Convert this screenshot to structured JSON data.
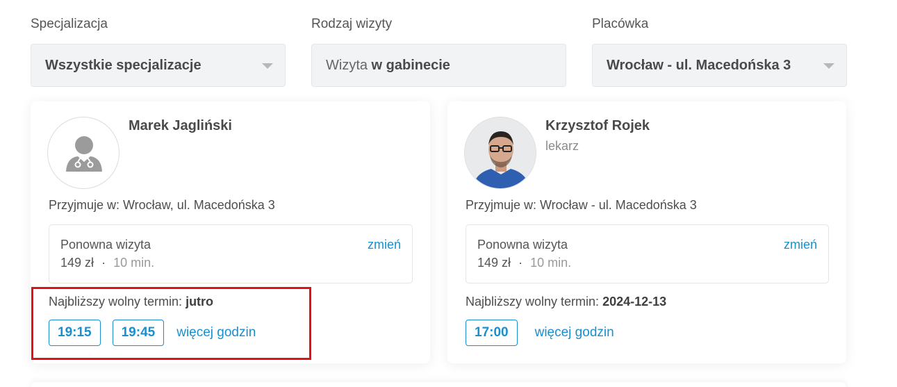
{
  "filters": {
    "specialization": {
      "label": "Specjalizacja",
      "value": "Wszystkie specjalizacje"
    },
    "visit_type": {
      "label": "Rodzaj wizyty",
      "value_prefix": "Wizyta",
      "value_bold": " w gabinecie"
    },
    "facility": {
      "label": "Placówka",
      "value": "Wrocław - ul. Macedońska 3"
    }
  },
  "doctors": [
    {
      "name": "Marek Jagliński",
      "role": "",
      "avatar": "doctor-placeholder-icon",
      "location": "Przyjmuje w: Wrocław, ul. Macedońska 3",
      "visit": {
        "name": "Ponowna wizyta",
        "price": "149 zł",
        "separator": "·",
        "duration": "10 min.",
        "change": "zmień"
      },
      "nearest_label": "Najbliższy wolny termin: ",
      "nearest_value": "jutro",
      "slots": [
        "19:15",
        "19:45"
      ],
      "more": "więcej godzin"
    },
    {
      "name": "Krzysztof Rojek",
      "role": "lekarz",
      "avatar": "doctor-photo",
      "location": "Przyjmuje w: Wrocław - ul. Macedońska 3",
      "visit": {
        "name": "Ponowna wizyta",
        "price": "149 zł",
        "separator": "·",
        "duration": "10 min.",
        "change": "zmień"
      },
      "nearest_label": "Najbliższy wolny termin: ",
      "nearest_value": "2024-12-13",
      "slots": [
        "17:00"
      ],
      "more": "więcej godzin"
    }
  ],
  "colors": {
    "accent": "#1a8fcf",
    "highlight": "#e0111b"
  }
}
